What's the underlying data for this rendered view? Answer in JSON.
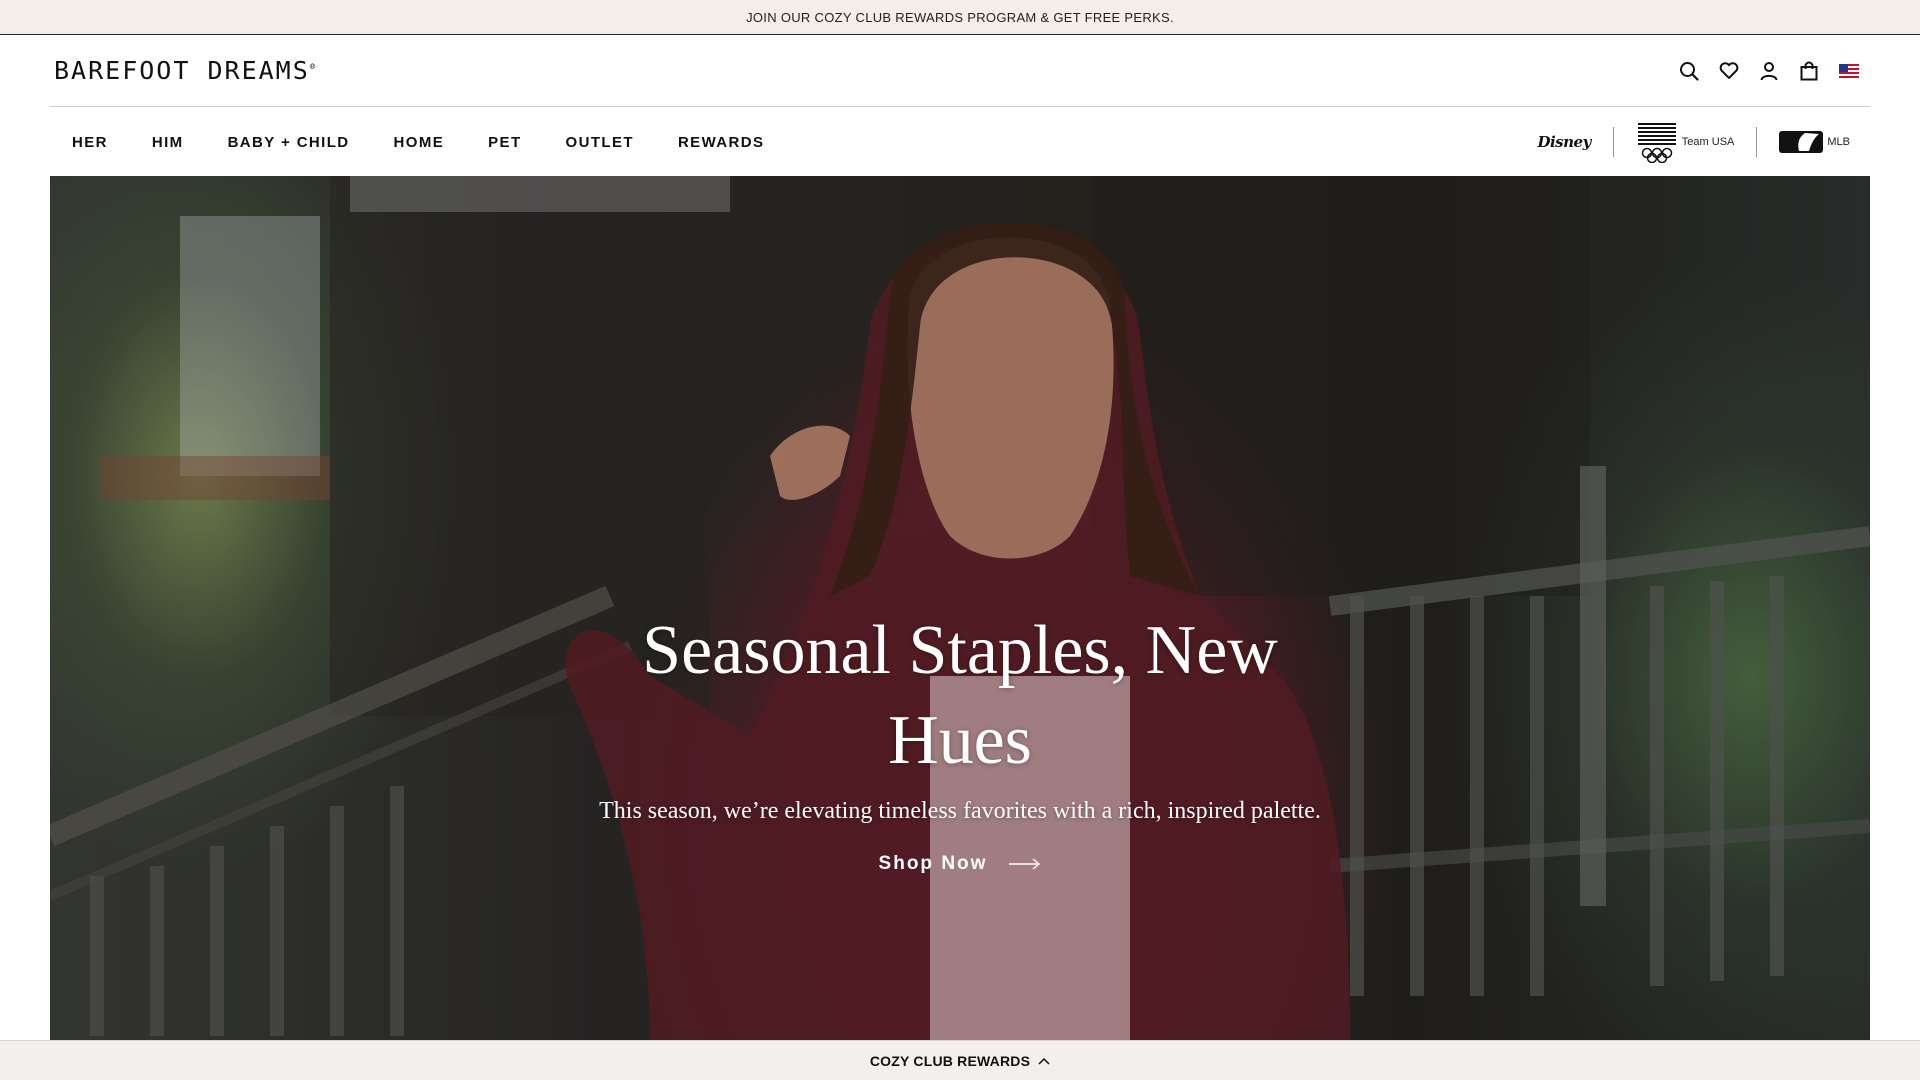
{
  "announcement": {
    "text": "JOIN OUR COZY CLUB REWARDS PROGRAM & GET FREE PERKS."
  },
  "header": {
    "logo": "BAREFOOT DREAMS",
    "logo_mark": "®",
    "icons": [
      "search-icon",
      "heart-icon",
      "account-icon",
      "bag-icon",
      "us-flag-icon"
    ]
  },
  "nav": {
    "links": [
      {
        "label": "HER"
      },
      {
        "label": "HIM"
      },
      {
        "label": "BABY + CHILD"
      },
      {
        "label": "HOME"
      },
      {
        "label": "PET"
      },
      {
        "label": "OUTLET"
      },
      {
        "label": "REWARDS"
      }
    ],
    "partners": {
      "disney": "Disney",
      "team_usa": "Team USA",
      "mlb": "MLB"
    }
  },
  "hero": {
    "title": "Seasonal Staples, New Hues",
    "subtitle": "This season, we’re elevating timeless favorites with a rich, inspired palette.",
    "cta": "Shop Now"
  },
  "rewards_bar": {
    "label": "COZY CLUB REWARDS"
  },
  "colors": {
    "announcement_bg": "#f5eee9",
    "hero_text": "#ffffff",
    "cardigan": "#6e2a33"
  }
}
